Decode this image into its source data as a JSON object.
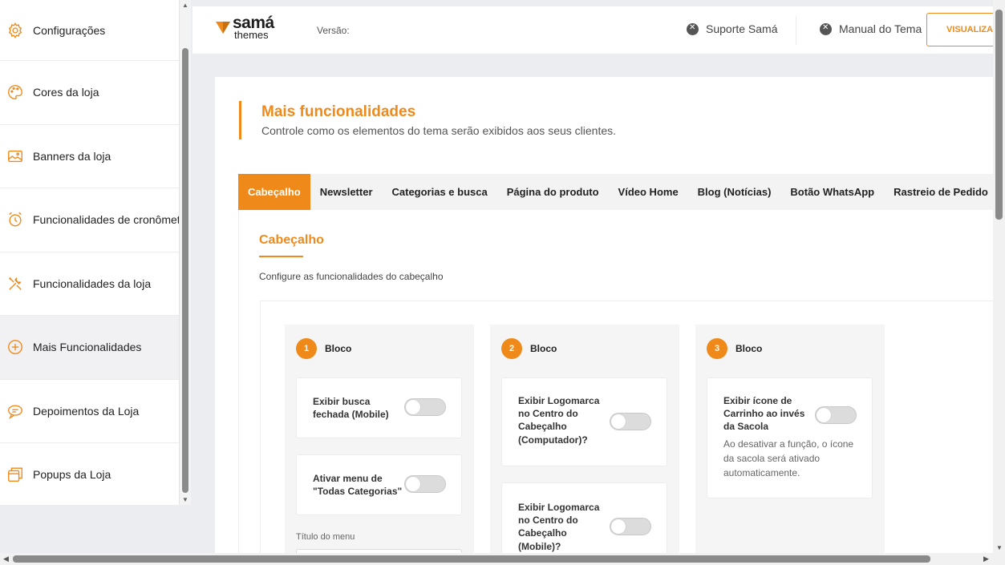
{
  "sidebar": {
    "items": [
      {
        "label": "Configurações",
        "icon": "gear-icon"
      },
      {
        "label": "Cores da loja",
        "icon": "palette-icon"
      },
      {
        "label": "Banners da loja",
        "icon": "image-icon"
      },
      {
        "label": "Funcionalidades de cronômetro",
        "icon": "alarm-clock-icon"
      },
      {
        "label": "Funcionalidades da loja",
        "icon": "tools-icon"
      },
      {
        "label": "Mais Funcionalidades",
        "icon": "plus-circle-icon"
      },
      {
        "label": "Depoimentos da Loja",
        "icon": "chat-bubble-icon"
      },
      {
        "label": "Popups da Loja",
        "icon": "popup-window-icon"
      }
    ]
  },
  "header": {
    "logo_top": "samá",
    "logo_bottom": "themes",
    "version_label": "Versão:",
    "suporte": "Suporte Samá",
    "manual": "Manual do Tema",
    "visualizar": "VISUALIZAR"
  },
  "page": {
    "title": "Mais funcionalidades",
    "subtitle": "Controle como os elementos do tema serão exibidos aos seus clientes."
  },
  "tabs": [
    "Cabeçalho",
    "Newsletter",
    "Categorias e busca",
    "Página do produto",
    "Vídeo Home",
    "Blog (Notícias)",
    "Botão WhatsApp",
    "Rastreio de Pedido"
  ],
  "section": {
    "title": "Cabeçalho",
    "subtitle": "Configure as funcionalidades do cabeçalho"
  },
  "blocks": [
    {
      "num": "1",
      "label": "Bloco",
      "opt1": "Exibir busca\nfechada (Mobile)",
      "opt2": "Ativar menu de\n\"Todas Categorias\"",
      "field_label": "Título do menu"
    },
    {
      "num": "2",
      "label": "Bloco",
      "opt1": "Exibir Logomarca\nno Centro do\nCabeçalho\n(Computador)?",
      "opt2": "Exibir Logomarca\nno Centro do\nCabeçalho\n(Mobile)?"
    },
    {
      "num": "3",
      "label": "Bloco",
      "opt1": "Exibir ícone de\nCarrinho ao invés\nda Sacola",
      "opt1_desc": "Ao desativar a função, o ícone da sacola será ativado automaticamente."
    }
  ],
  "colors": {
    "accent": "#ef8a1a",
    "background": "#ecedf1"
  }
}
